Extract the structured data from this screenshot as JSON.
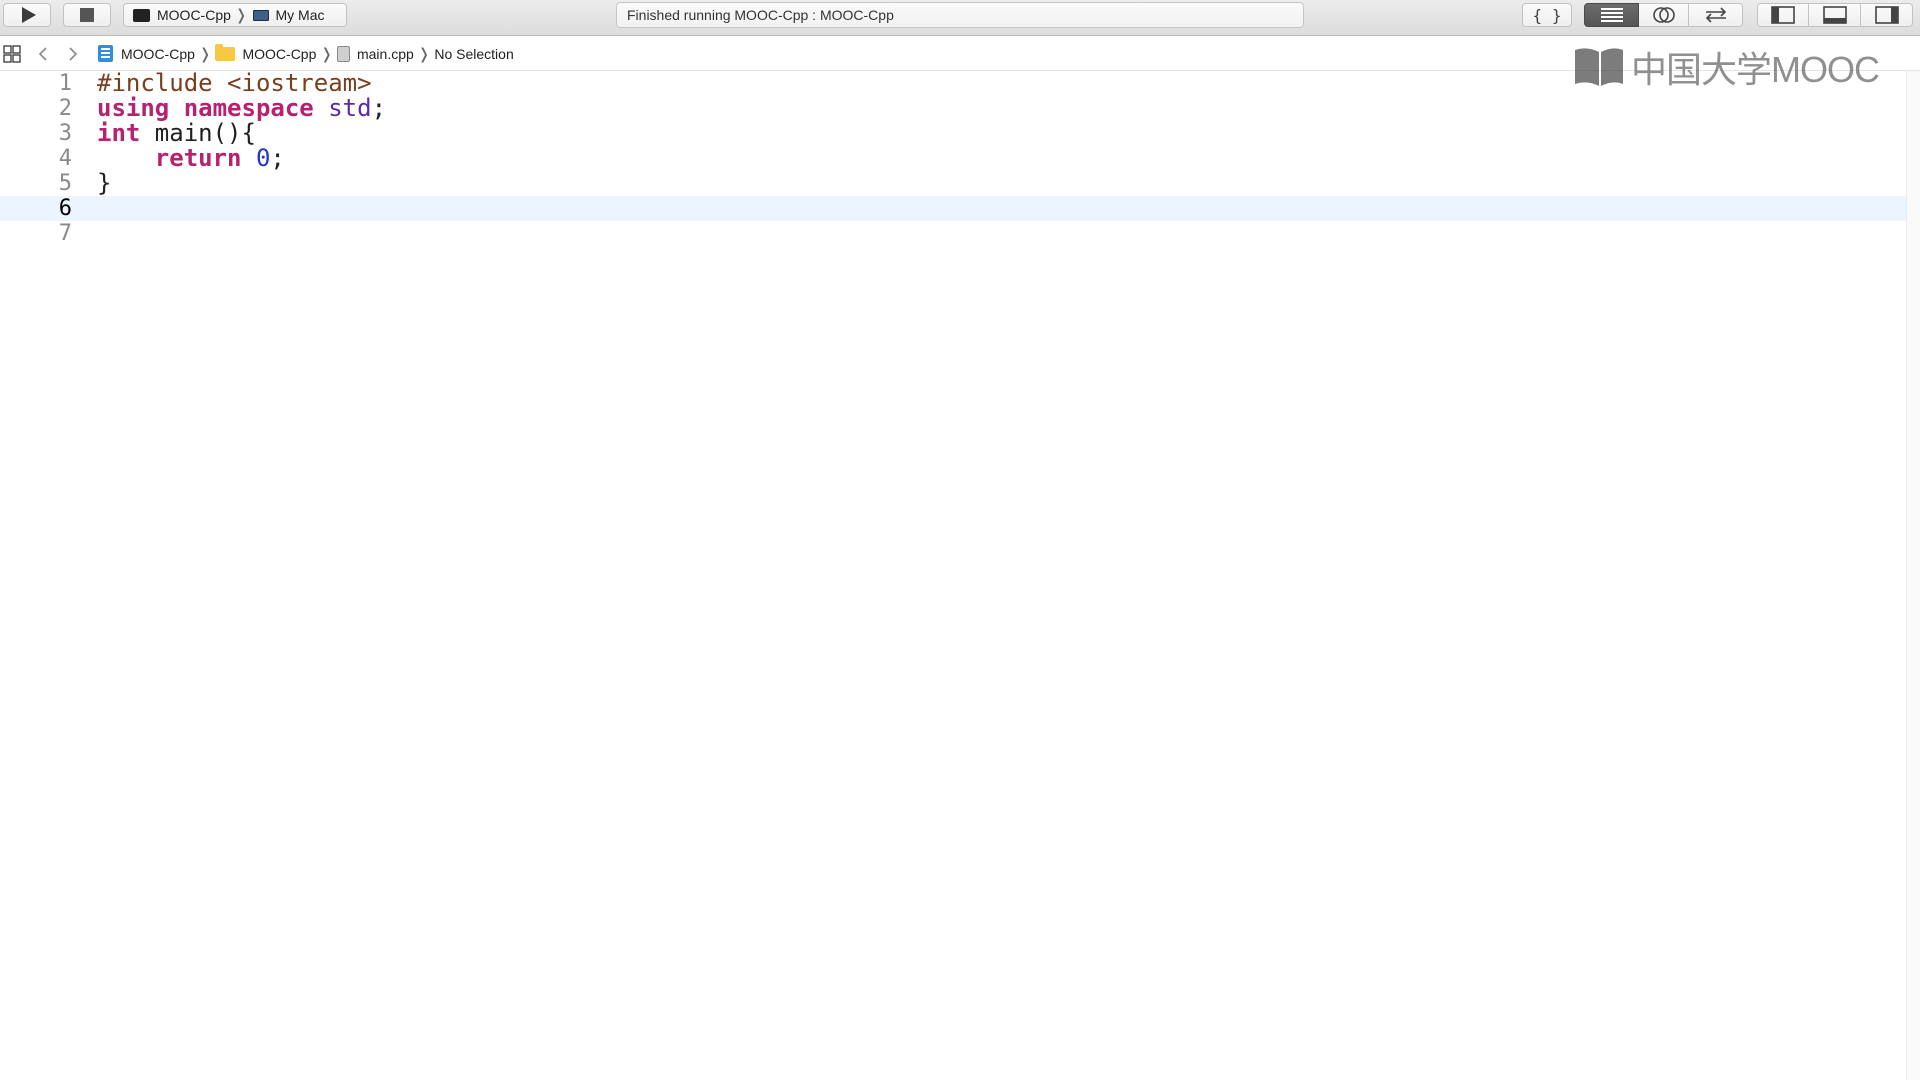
{
  "toolbar": {
    "scheme": "MOOC-Cpp",
    "destination": "My Mac",
    "activity_status": "Finished running MOOC-Cpp : MOOC-Cpp",
    "icons": [
      "play-icon",
      "stop-icon",
      "braces-icon",
      "standard-editor-icon",
      "assistant-editor-icon",
      "version-editor-icon",
      "navigator-toggle-icon",
      "debug-area-toggle-icon",
      "utilities-toggle-icon"
    ]
  },
  "jumpbar": {
    "project": "MOOC-Cpp",
    "group": "MOOC-Cpp",
    "file": "main.cpp",
    "selection": "No Selection"
  },
  "editor": {
    "current_line": 6,
    "lines": [
      {
        "number": "1",
        "tokens": [
          {
            "t": "#include <iostream>",
            "c": "pp"
          }
        ]
      },
      {
        "number": "2",
        "tokens": [
          {
            "t": "using",
            "c": "kw"
          },
          {
            "t": " ",
            "c": ""
          },
          {
            "t": "namespace",
            "c": "kw"
          },
          {
            "t": " ",
            "c": ""
          },
          {
            "t": "std",
            "c": "ty"
          },
          {
            "t": ";",
            "c": ""
          }
        ]
      },
      {
        "number": "3",
        "tokens": [
          {
            "t": "int",
            "c": "kw"
          },
          {
            "t": " main(){",
            "c": ""
          }
        ]
      },
      {
        "number": "4",
        "tokens": [
          {
            "t": "    ",
            "c": ""
          },
          {
            "t": "return",
            "c": "kw"
          },
          {
            "t": " ",
            "c": ""
          },
          {
            "t": "0",
            "c": "num"
          },
          {
            "t": ";",
            "c": ""
          }
        ]
      },
      {
        "number": "5",
        "tokens": [
          {
            "t": "}",
            "c": ""
          }
        ]
      },
      {
        "number": "6",
        "tokens": []
      },
      {
        "number": "7",
        "tokens": []
      }
    ]
  },
  "watermark": {
    "text": "中国大学MOOC"
  },
  "colors": {
    "keyword": "#b6226f",
    "preprocessor": "#7a3e1d",
    "type": "#5a2aa8",
    "number": "#2536c9",
    "current_line": "#ecf5ff"
  }
}
